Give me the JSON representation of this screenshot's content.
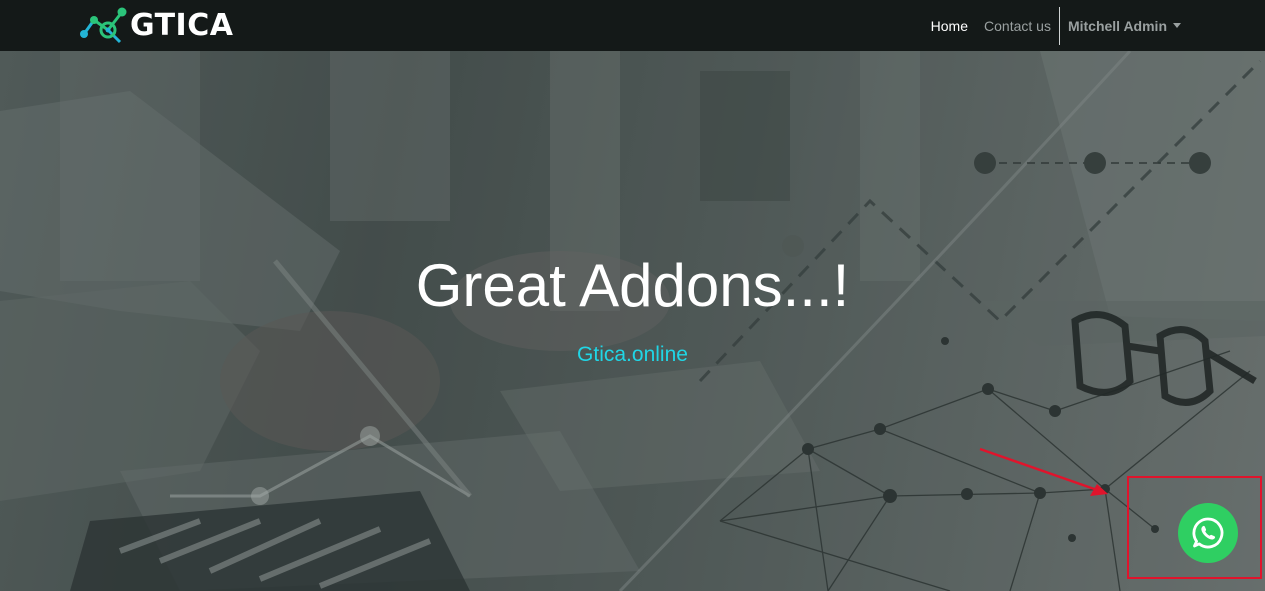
{
  "navbar": {
    "brand_name": "GTICA",
    "logo_icon": "network-chart-icon",
    "links": [
      {
        "label": "Home",
        "active": true
      },
      {
        "label": "Contact us",
        "active": false
      }
    ],
    "user": {
      "label": "Mitchell Admin",
      "icon": "caret-down-icon"
    }
  },
  "hero": {
    "title": "Great Addons...!",
    "subtitle": "Gtica.online",
    "subtitle_color": "#20d6e6",
    "background": "business-analytics-photo"
  },
  "floating": {
    "whatsapp_icon": "whatsapp-icon",
    "whatsapp_color": "#2fcf62",
    "annotation_color": "#e0142c"
  }
}
